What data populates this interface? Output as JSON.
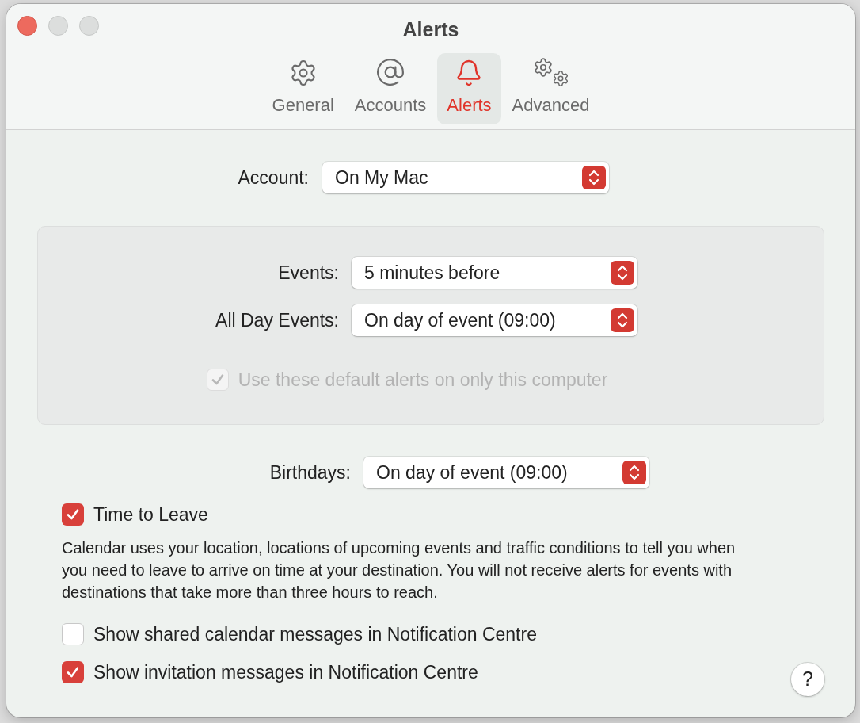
{
  "window": {
    "title": "Alerts"
  },
  "tabs": [
    {
      "label": "General",
      "kind": "gear",
      "selected": false
    },
    {
      "label": "Accounts",
      "kind": "at",
      "selected": false
    },
    {
      "label": "Alerts",
      "kind": "bell",
      "selected": true
    },
    {
      "label": "Advanced",
      "kind": "gears",
      "selected": false
    }
  ],
  "account": {
    "label": "Account:",
    "value": "On My Mac"
  },
  "defaults": {
    "rows": [
      {
        "label": "Events:",
        "value": "5 minutes before"
      },
      {
        "label": "All Day Events:",
        "value": "On day of event (09:00)"
      }
    ],
    "checkbox": {
      "label": "Use these default alerts on only this computer",
      "checked": true,
      "disabled": true
    }
  },
  "birthdays": {
    "label": "Birthdays:",
    "value": "On day of event (09:00)"
  },
  "time_to_leave": {
    "label": "Time to Leave",
    "checked": true,
    "disabled": false
  },
  "description": "Calendar uses your location, locations of upcoming events and traffic conditions to tell you when you need to leave to arrive on time at your destination. You will not receive alerts for events with destinations that take more than three hours to reach.",
  "options": [
    {
      "label": "Show shared calendar messages in Notification Centre",
      "checked": false,
      "disabled": false
    },
    {
      "label": "Show invitation messages in Notification Centre",
      "checked": true,
      "disabled": false
    }
  ],
  "help_button": "?"
}
